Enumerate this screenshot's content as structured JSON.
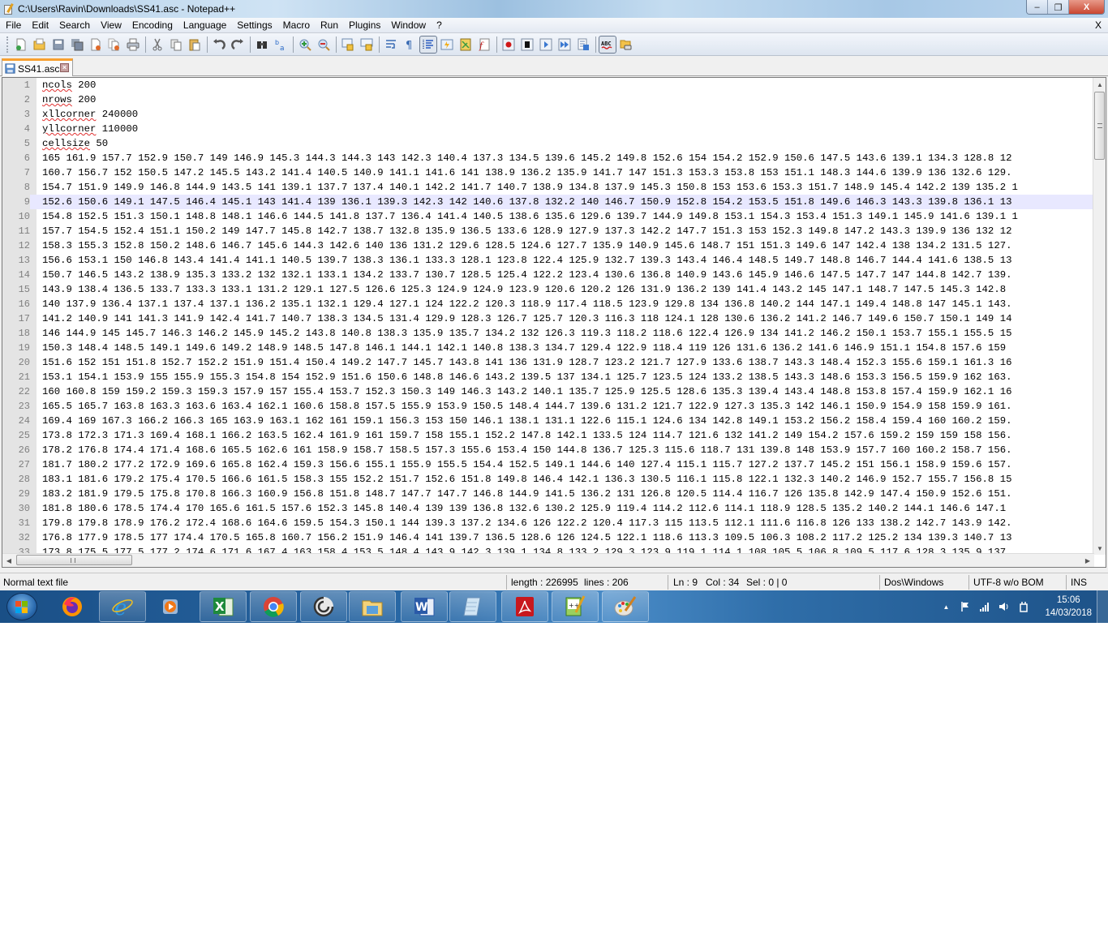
{
  "window": {
    "title": "C:\\Users\\Ravin\\Downloads\\SS41.asc - Notepad++",
    "controls": {
      "minimize": "–",
      "restore": "❐",
      "close": "X"
    }
  },
  "menu": {
    "items": [
      "File",
      "Edit",
      "Search",
      "View",
      "Encoding",
      "Language",
      "Settings",
      "Macro",
      "Run",
      "Plugins",
      "Window",
      "?"
    ],
    "close_document": "X"
  },
  "toolbar": {
    "buttons": [
      {
        "icon": "new-file-icon"
      },
      {
        "icon": "open-file-icon"
      },
      {
        "icon": "save-icon"
      },
      {
        "icon": "save-all-icon"
      },
      {
        "icon": "close-icon"
      },
      {
        "icon": "close-all-icon"
      },
      {
        "icon": "print-icon"
      },
      {
        "icon": "cut-icon"
      },
      {
        "icon": "copy-icon"
      },
      {
        "icon": "paste-icon"
      },
      {
        "icon": "undo-icon"
      },
      {
        "icon": "redo-icon"
      },
      {
        "icon": "find-icon"
      },
      {
        "icon": "replace-icon"
      },
      {
        "icon": "zoom-in-icon"
      },
      {
        "icon": "zoom-out-icon"
      },
      {
        "icon": "sync-vertical-icon"
      },
      {
        "icon": "sync-horizontal-icon"
      },
      {
        "icon": "word-wrap-icon"
      },
      {
        "icon": "show-all-characters-icon"
      },
      {
        "icon": "indent-guide-icon",
        "active": true
      },
      {
        "icon": "user-defined-language-icon"
      },
      {
        "icon": "document-map-icon"
      },
      {
        "icon": "function-list-icon"
      },
      {
        "icon": "record-macro-icon"
      },
      {
        "icon": "stop-recording-icon"
      },
      {
        "icon": "play-macro-icon"
      },
      {
        "icon": "run-macro-multiple-icon"
      },
      {
        "icon": "save-macro-icon"
      },
      {
        "icon": "spell-check-icon",
        "active": true
      },
      {
        "icon": "folder-as-workspace-icon"
      }
    ]
  },
  "tabs": [
    {
      "label": "SS41.asc",
      "active": true,
      "close": "×"
    }
  ],
  "editor": {
    "current_line": 9,
    "lines": [
      {
        "n": "1",
        "kw": "ncols",
        "rest": " 200"
      },
      {
        "n": "2",
        "kw": "nrows",
        "rest": " 200"
      },
      {
        "n": "3",
        "kw": "xllcorner",
        "rest": " 240000"
      },
      {
        "n": "4",
        "kw": "yllcorner",
        "rest": " 110000"
      },
      {
        "n": "5",
        "kw": "cellsize",
        "rest": " 50"
      },
      {
        "n": "6",
        "text": "165 161.9 157.7 152.9 150.7 149 146.9 145.3 144.3 144.3 143 142.3 140.4 137.3 134.5 139.6 145.2 149.8 152.6 154 154.2 152.9 150.6 147.5 143.6 139.1 134.3 128.8 12"
      },
      {
        "n": "7",
        "text": "160.7 156.7 152 150.5 147.2 145.5 143.2 141.4 140.5 140.9 141.1 141.6 141 138.9 136.2 135.9 141.7 147 151.3 153.3 153.8 153 151.1 148.3 144.6 139.9 136 132.6 129."
      },
      {
        "n": "8",
        "text": "154.7 151.9 149.9 146.8 144.9 143.5 141 139.1 137.7 137.4 140.1 142.2 141.7 140.7 138.9 134.8 137.9 145.3 150.8 153 153.6 153.3 151.7 148.9 145.4 142.2 139 135.2 1"
      },
      {
        "n": "9",
        "text": "152.6 150.6 149.1 147.5 146.4 145.1 143 141.4 139 136.1 139.3 142.3 142 140.6 137.8 132.2 140 146.7 150.9 152.8 154.2 153.5 151.8 149.6 146.3 143.3 139.8 136.1 13"
      },
      {
        "n": "10",
        "text": "154.8 152.5 151.3 150.1 148.8 148.1 146.6 144.5 141.8 137.7 136.4 141.4 140.5 138.6 135.6 129.6 139.7 144.9 149.8 153.1 154.3 153.4 151.3 149.1 145.9 141.6 139.1 1"
      },
      {
        "n": "11",
        "text": "157.7 154.5 152.4 151.1 150.2 149 147.7 145.8 142.7 138.7 132.8 135.9 136.5 133.6 128.9 127.9 137.3 142.2 147.7 151.3 153 152.3 149.8 147.2 143.3 139.9 136 132 12"
      },
      {
        "n": "12",
        "text": "158.3 155.3 152.8 150.2 148.6 146.7 145.6 144.3 142.6 140 136 131.2 129.6 128.5 124.6 127.7 135.9 140.9 145.6 148.7 151 151.3 149.6 147 142.4 138 134.2 131.5 127."
      },
      {
        "n": "13",
        "text": "156.6 153.1 150 146.8 143.4 141.4 141.1 140.5 139.7 138.3 136.1 133.3 128.1 123.8 122.4 125.9 132.7 139.3 143.4 146.4 148.5 149.7 148.8 146.7 144.4 141.6 138.5 13"
      },
      {
        "n": "14",
        "text": "150.7 146.5 143.2 138.9 135.3 133.2 132 132.1 133.1 134.2 133.7 130.7 128.5 125.4 122.2 123.4 130.6 136.8 140.9 143.6 145.9 146.6 147.5 147.7 147 144.8 142.7 139."
      },
      {
        "n": "15",
        "text": "143.9 138.4 136.5 133.7 133.3 133.1 131.2 129.1 127.5 126.6 125.3 124.9 124.9 123.9 120.6 120.2 126 131.9 136.2 139 141.4 143.2 145 147.1 148.7 147.5 145.3 142.8"
      },
      {
        "n": "16",
        "text": "140 137.9 136.4 137.1 137.4 137.1 136.2 135.1 132.1 129.4 127.1 124 122.2 120.3 118.9 117.4 118.5 123.9 129.8 134 136.8 140.2 144 147.1 149.4 148.8 147 145.1 143."
      },
      {
        "n": "17",
        "text": "141.2 140.9 141 141.3 141.9 142.4 141.7 140.7 138.3 134.5 131.4 129.9 128.3 126.7 125.7 120.3 116.3 118 124.1 128 130.6 136.2 141.2 146.7 149.6 150.7 150.1 149 14"
      },
      {
        "n": "18",
        "text": "146 144.9 145 145.7 146.3 146.2 145.9 145.2 143.8 140.8 138.3 135.9 135.7 134.2 132 126.3 119.3 118.2 118.6 122.4 126.9 134 141.2 146.2 150.1 153.7 155.1 155.5 15"
      },
      {
        "n": "19",
        "text": "150.3 148.4 148.5 149.1 149.6 149.2 148.9 148.5 147.8 146.1 144.1 142.1 140.8 138.3 134.7 129.4 122.9 118.4 119 126 131.6 136.2 141.6 146.9 151.1 154.8 157.6 159"
      },
      {
        "n": "20",
        "text": "151.6 152 151 151.8 152.7 152.2 151.9 151.4 150.4 149.2 147.7 145.7 143.8 141 136 131.9 128.7 123.2 121.7 127.9 133.6 138.7 143.3 148.4 152.3 155.6 159.1 161.3 16"
      },
      {
        "n": "21",
        "text": "153.1 154.1 153.9 155 155.9 155.3 154.8 154 152.9 151.6 150.6 148.8 146.6 143.2 139.5 137 134.1 125.7 123.5 124 133.2 138.5 143.3 148.6 153.3 156.5 159.9 162 163."
      },
      {
        "n": "22",
        "text": "160 160.8 159 159.2 159.3 159.3 157.9 157 155.4 153.7 152.3 150.3 149 146.3 143.2 140.1 135.7 125.9 125.5 128.6 135.3 139.4 143.4 148.8 153.8 157.4 159.9 162.1 16"
      },
      {
        "n": "23",
        "text": "165.5 165.7 163.8 163.3 163.6 163.4 162.1 160.6 158.8 157.5 155.9 153.9 150.5 148.4 144.7 139.6 131.2 121.7 122.9 127.3 135.3 142 146.1 150.9 154.9 158 159.9 161."
      },
      {
        "n": "24",
        "text": "169.4 169 167.3 166.2 166.3 165 163.9 163.1 162 161 159.1 156.3 153 150 146.1 138.1 131.1 122.6 115.1 124.6 134 142.8 149.1 153.2 156.2 158.4 159.4 160 160.2 159."
      },
      {
        "n": "25",
        "text": "173.8 172.3 171.3 169.4 168.1 166.2 163.5 162.4 161.9 161 159.7 158 155.1 152.2 147.8 142.1 133.5 124 114.7 121.6 132 141.2 149 154.2 157.6 159.2 159 159 158 156."
      },
      {
        "n": "26",
        "text": "178.2 176.8 174.4 171.4 168.6 165.5 162.6 161 158.9 158.7 158.5 157.3 155.6 153.4 150 144.8 136.7 125.3 115.6 118.7 131 139.8 148 153.9 157.7 160 160.2 158.7 156."
      },
      {
        "n": "27",
        "text": "181.7 180.2 177.2 172.9 169.6 165.8 162.4 159.3 156.6 155.1 155.9 155.5 154.4 152.5 149.1 144.6 140 127.4 115.1 115.7 127.2 137.7 145.2 151 156.1 158.9 159.6 157."
      },
      {
        "n": "28",
        "text": "183.1 181.6 179.2 175.4 170.5 166.6 161.5 158.3 155 152.2 151.7 152.6 151.8 149.8 146.4 142.1 136.3 130.5 116.1 115.8 122.1 132.3 140.2 146.9 152.7 155.7 156.8 15"
      },
      {
        "n": "29",
        "text": "183.2 181.9 179.5 175.8 170.8 166.3 160.9 156.8 151.8 148.7 147.7 147.7 146.8 144.9 141.5 136.2 131 126.8 120.5 114.4 116.7 126 135.8 142.9 147.4 150.9 152.6 151."
      },
      {
        "n": "30",
        "text": "181.8 180.6 178.5 174.4 170 165.6 161.5 157.6 152.3 145.8 140.4 139 139 136.8 132.6 130.2 125.9 119.4 114.2 112.6 114.1 118.9 128.5 135.2 140.2 144.1 146.6 147.1"
      },
      {
        "n": "31",
        "text": "179.8 179.8 178.9 176.2 172.4 168.6 164.6 159.5 154.3 150.1 144 139.3 137.2 134.6 126 122.2 120.4 117.3 115 113.5 112.1 111.6 116.8 126 133 138.2 142.7 143.9 142."
      },
      {
        "n": "32",
        "text": "176.8 177.9 178.5 177 174.4 170.5 165.8 160.7 156.2 151.9 146.4 141 139.7 136.5 128.6 126 124.5 122.1 118.6 113.3 109.5 106.3 108.2 117.2 125.2 134 139.3 140.7 13"
      },
      {
        "n": "33",
        "text": "173.8 175.5 177.5 177.2 174.6 171.6 167.4 163 158.4 153.5 148.4 143.9 142.3 139.1 134.8 133.2 129.3 123.9 119.1 114.1 108 105.5 106.8 109.5 117.6 128.3 135.9 137."
      }
    ]
  },
  "scrollbars": {
    "up": "▲",
    "down": "▼",
    "left": "◀",
    "right": "▶"
  },
  "status": {
    "file_type": "Normal text file",
    "length": "length : 226995",
    "lines": "lines : 206",
    "ln": "Ln : 9",
    "col": "Col : 34",
    "sel": "Sel : 0 | 0",
    "eol": "Dos\\Windows",
    "encoding": "UTF-8 w/o BOM",
    "mode": "INS"
  },
  "taskbar": {
    "apps": [
      {
        "name": "firefox"
      },
      {
        "name": "internet-explorer"
      },
      {
        "name": "windows-media-player"
      },
      {
        "name": "excel"
      },
      {
        "name": "chrome"
      },
      {
        "name": "app-swirl"
      },
      {
        "name": "file-explorer"
      },
      {
        "name": "word"
      },
      {
        "name": "notepad"
      },
      {
        "name": "acrobat-reader"
      },
      {
        "name": "notepad-plus-plus"
      },
      {
        "name": "paint"
      }
    ],
    "tray": {
      "show_hidden": "▲",
      "time": "15:06",
      "date": "14/03/2018"
    }
  }
}
